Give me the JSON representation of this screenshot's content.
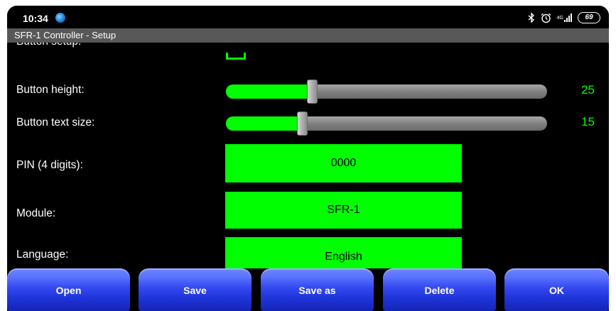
{
  "status_bar": {
    "time": "10:34",
    "app_icon": "browser-globe-icon",
    "icons": [
      "bluetooth-icon",
      "alarm-clock-icon",
      "signal-4g-icon",
      "battery-icon"
    ],
    "network_type": "4G",
    "battery": "69"
  },
  "app": {
    "title": "SFR-1 Controller - Setup"
  },
  "settings": {
    "partial_label": "Button setup:",
    "button_height": {
      "label": "Button height:",
      "value": "25",
      "level": 0.26
    },
    "button_text_size": {
      "label": "Button text size:",
      "value": "15",
      "level": 0.23
    },
    "pin": {
      "label": "PIN (4 digits):",
      "value": "0000"
    },
    "module": {
      "label": "Module:",
      "value": "SFR-1"
    },
    "language": {
      "label": "Language:",
      "value": "English"
    }
  },
  "buttons": {
    "open": "Open",
    "save": "Save",
    "save_as": "Save as",
    "delete": "Delete",
    "ok": "OK"
  },
  "colors": {
    "accent_green": "#00ff00",
    "button_blue": "#2a3ee6",
    "title_bar": "#585858",
    "background": "#000000"
  }
}
